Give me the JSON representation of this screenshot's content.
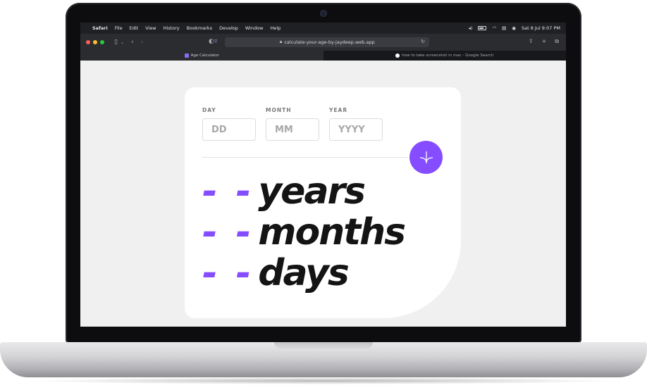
{
  "menubar": {
    "items": [
      "Safari",
      "File",
      "Edit",
      "View",
      "History",
      "Bookmarks",
      "Develop",
      "Window",
      "Help"
    ],
    "datetime": "Sat 8 Jul  9:07 PM"
  },
  "browser": {
    "url": "calculate-your-age-by-jaydeep.web.app",
    "tabs": [
      {
        "title": "Age Calculator",
        "active": true
      },
      {
        "title": "how to take screenshot in mac - Google Search",
        "active": false
      }
    ]
  },
  "form": {
    "day": {
      "label": "DAY",
      "placeholder": "DD"
    },
    "month": {
      "label": "MONTH",
      "placeholder": "MM"
    },
    "year": {
      "label": "YEAR",
      "placeholder": "YYYY"
    }
  },
  "result": {
    "years": {
      "value": "- -",
      "unit": "years"
    },
    "months": {
      "value": "- -",
      "unit": "months"
    },
    "days": {
      "value": "- -",
      "unit": "days"
    }
  },
  "colors": {
    "accent": "#854dff",
    "card": "#ffffff",
    "background": "#f0f0f0",
    "text": "#141414"
  }
}
